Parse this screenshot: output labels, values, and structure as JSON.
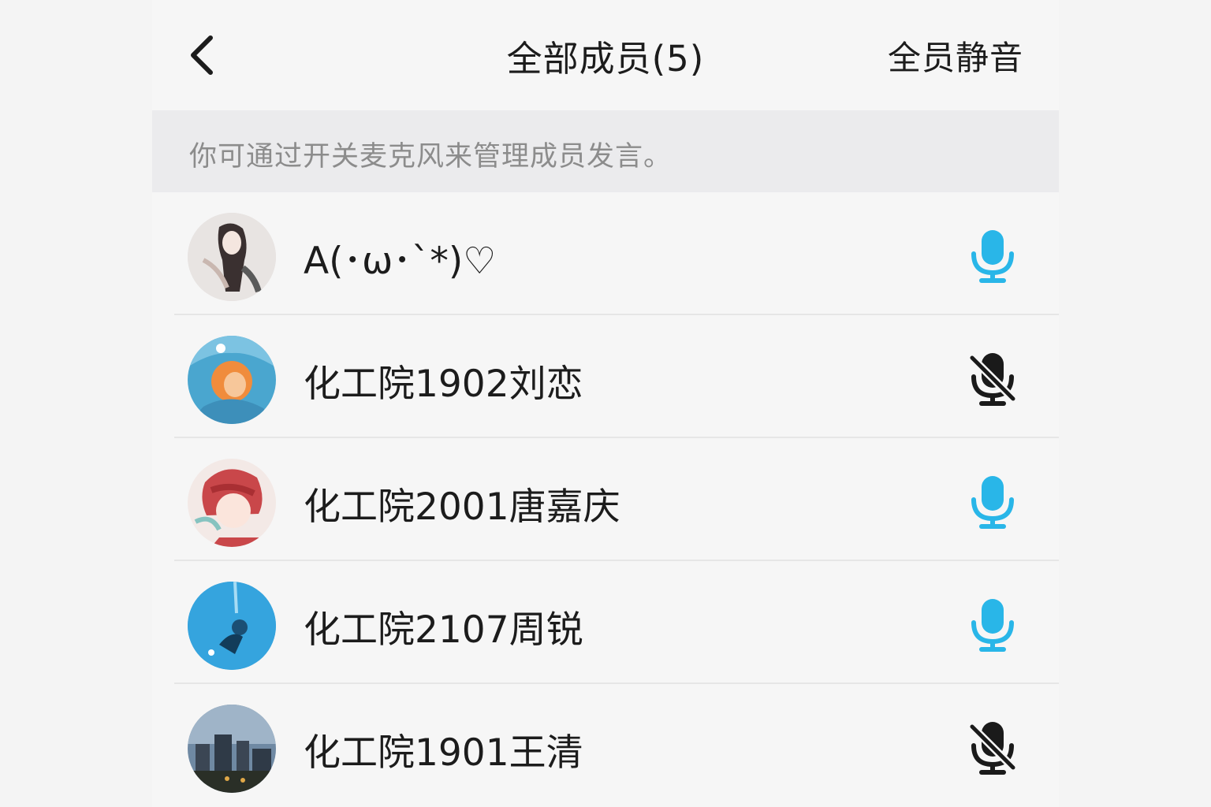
{
  "header": {
    "back_icon": "chevron-left-icon",
    "title": "全部成员(5)",
    "mute_all_label": "全员静音"
  },
  "hint": "你可通过开关麦克风来管理成员发言。",
  "colors": {
    "mic_on": "#29b6e8",
    "mic_off": "#1a1a1a"
  },
  "members": [
    {
      "name": "A(･ω･`*)♡",
      "mic": "on",
      "mic_icon": "microphone-icon"
    },
    {
      "name": "化工院1902刘恋",
      "mic": "off",
      "mic_icon": "microphone-muted-icon"
    },
    {
      "name": "化工院2001唐嘉庆",
      "mic": "on",
      "mic_icon": "microphone-icon"
    },
    {
      "name": "化工院2107周锐",
      "mic": "on",
      "mic_icon": "microphone-icon"
    },
    {
      "name": "化工院1901王清",
      "mic": "off",
      "mic_icon": "microphone-muted-icon"
    }
  ]
}
